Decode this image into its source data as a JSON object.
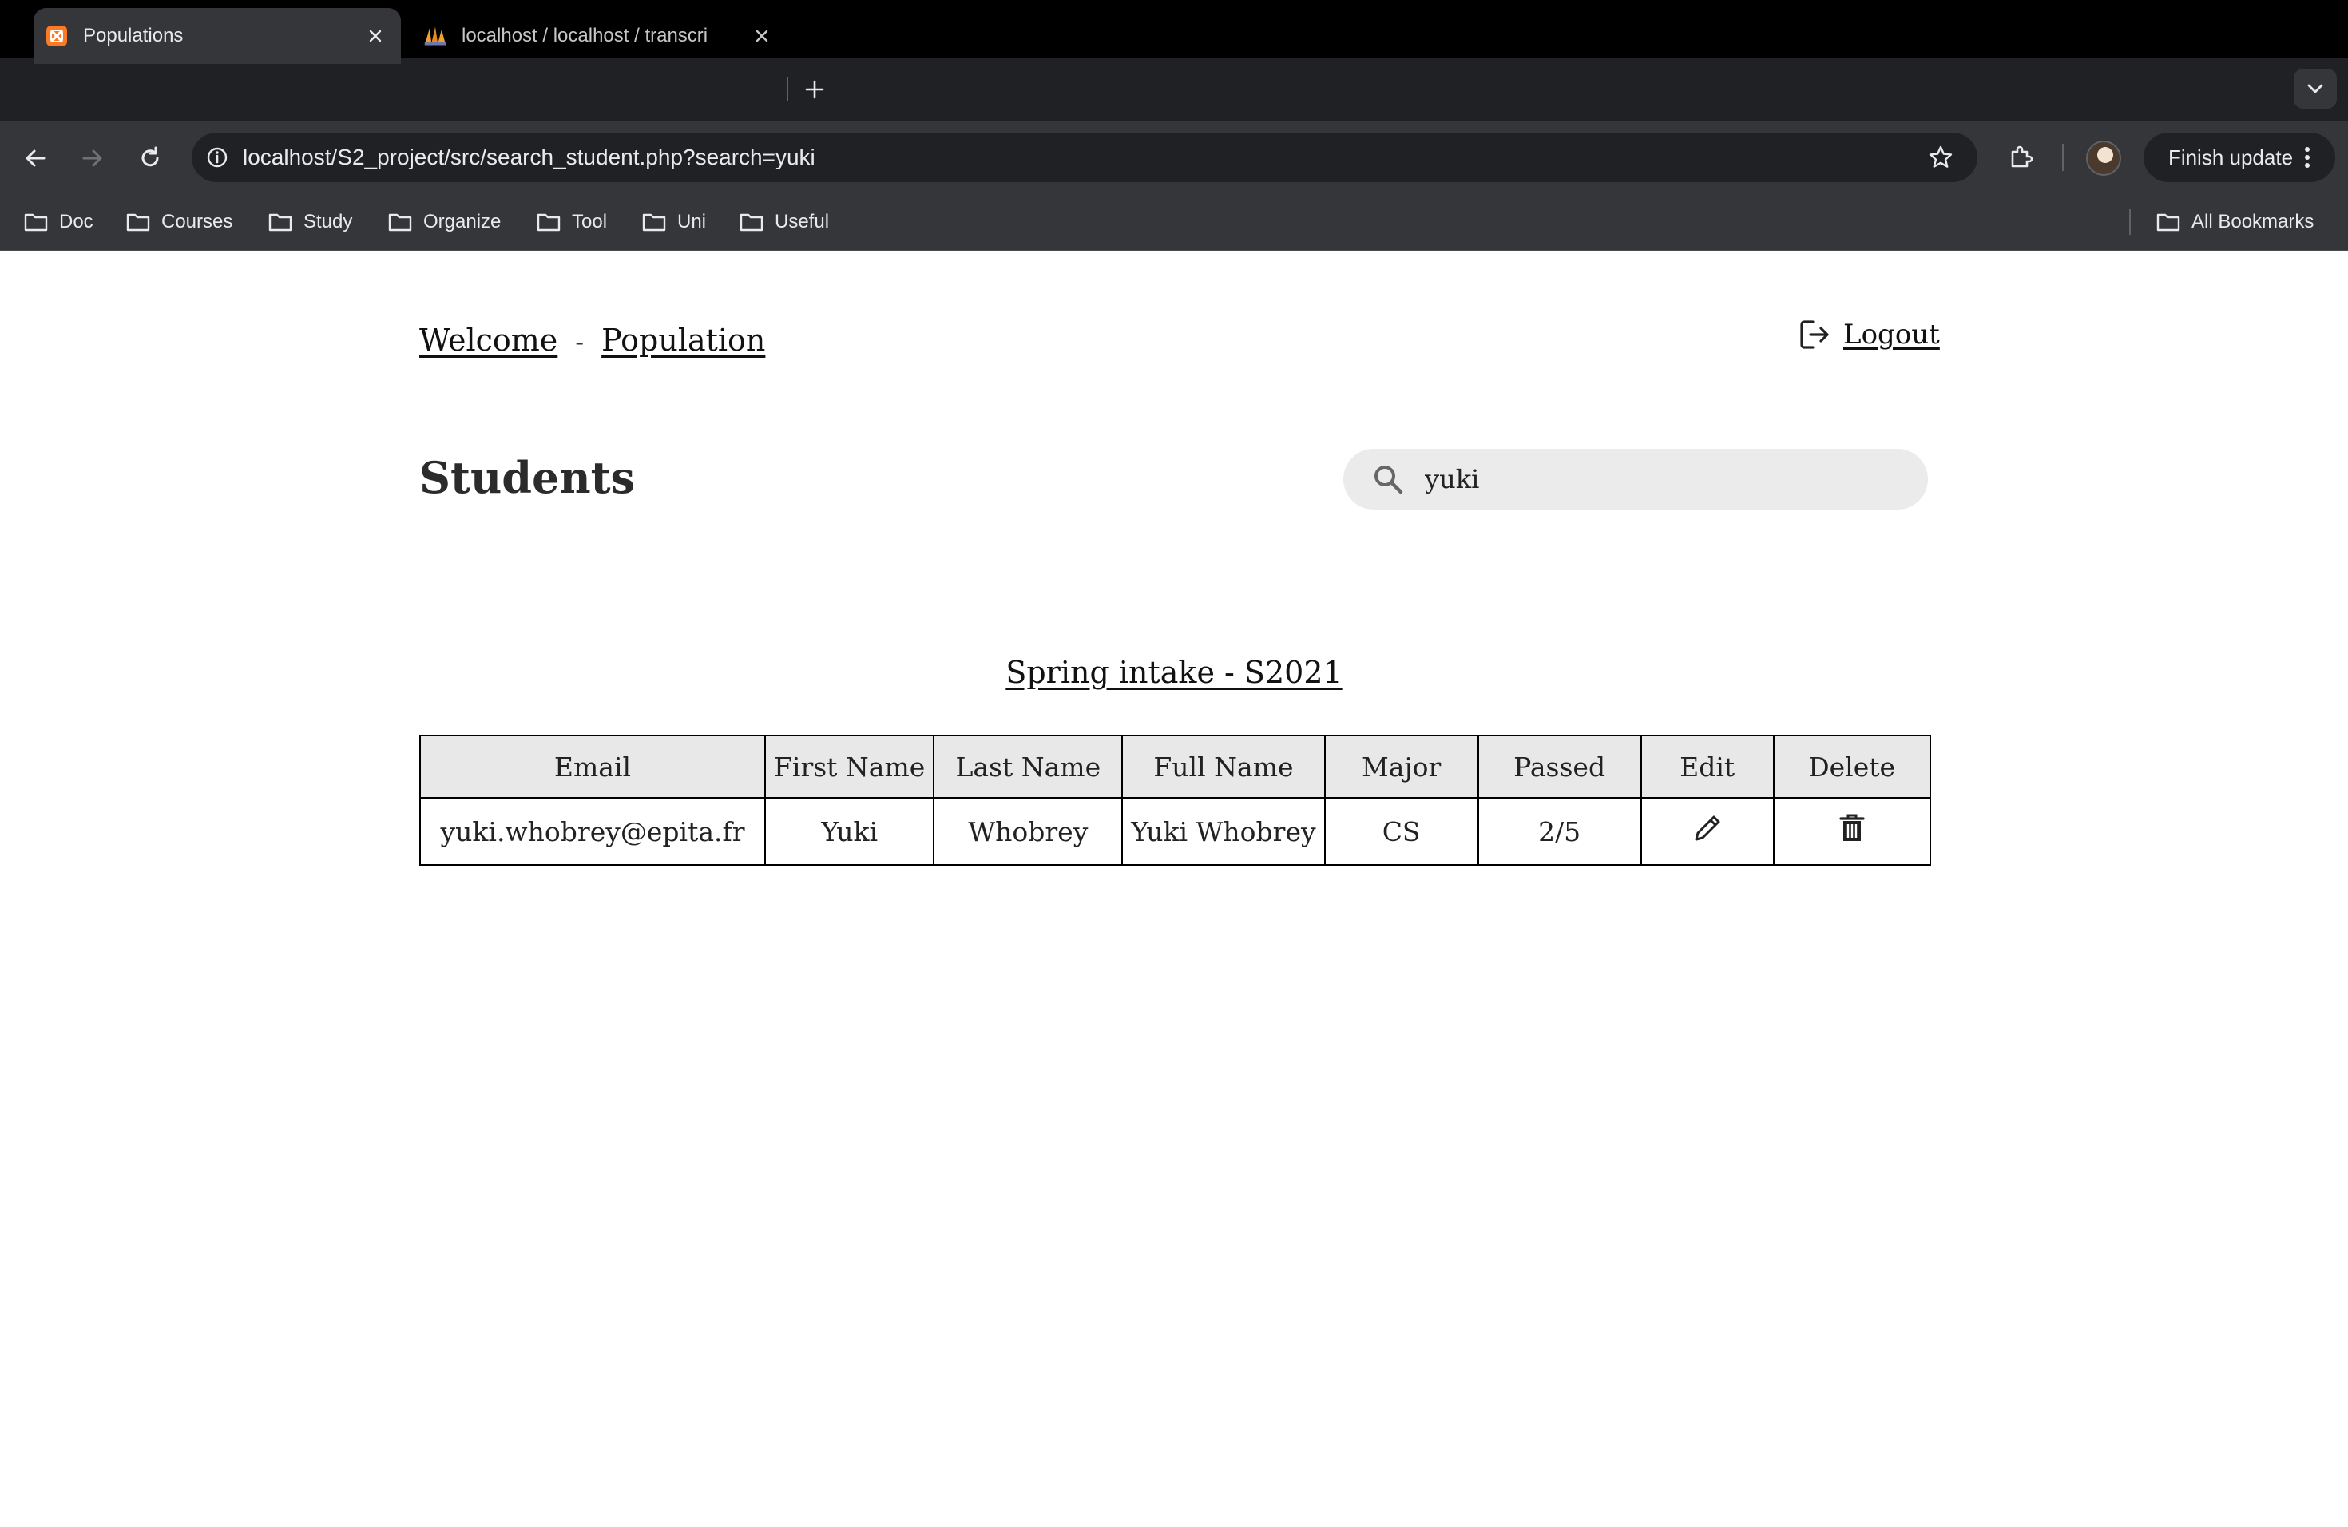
{
  "browser": {
    "tabs": [
      {
        "title": "Populations",
        "active": true,
        "favicon": "xampp-icon"
      },
      {
        "title": "localhost / localhost / transcri",
        "active": false,
        "favicon": "phpmyadmin-icon"
      }
    ],
    "address_bar": {
      "url": "localhost/S2_project/src/search_student.php?search=yuki"
    },
    "finish_update_label": "Finish update",
    "bookmarks": [
      "Doc",
      "Courses",
      "Study",
      "Organize",
      "Tool",
      "Uni",
      "Useful"
    ],
    "all_bookmarks_label": "All Bookmarks"
  },
  "page": {
    "nav": {
      "welcome": "Welcome",
      "separator": "-",
      "population": "Population"
    },
    "logout_label": "Logout",
    "title": "Students",
    "search": {
      "value": "yuki"
    },
    "intake_title": "Spring intake - S2021",
    "table": {
      "headers": [
        "Email",
        "First Name",
        "Last Name",
        "Full Name",
        "Major",
        "Passed",
        "Edit",
        "Delete"
      ],
      "rows": [
        {
          "email": "yuki.whobrey@epita.fr",
          "first_name": "Yuki",
          "last_name": "Whobrey",
          "full_name": "Yuki Whobrey",
          "major": "CS",
          "passed": "2/5"
        }
      ]
    }
  },
  "colors": {
    "chrome_dark": "#202124",
    "chrome_mid": "#35363a",
    "table_header_bg": "#e8e8e8",
    "search_bg": "#ebebeb"
  }
}
